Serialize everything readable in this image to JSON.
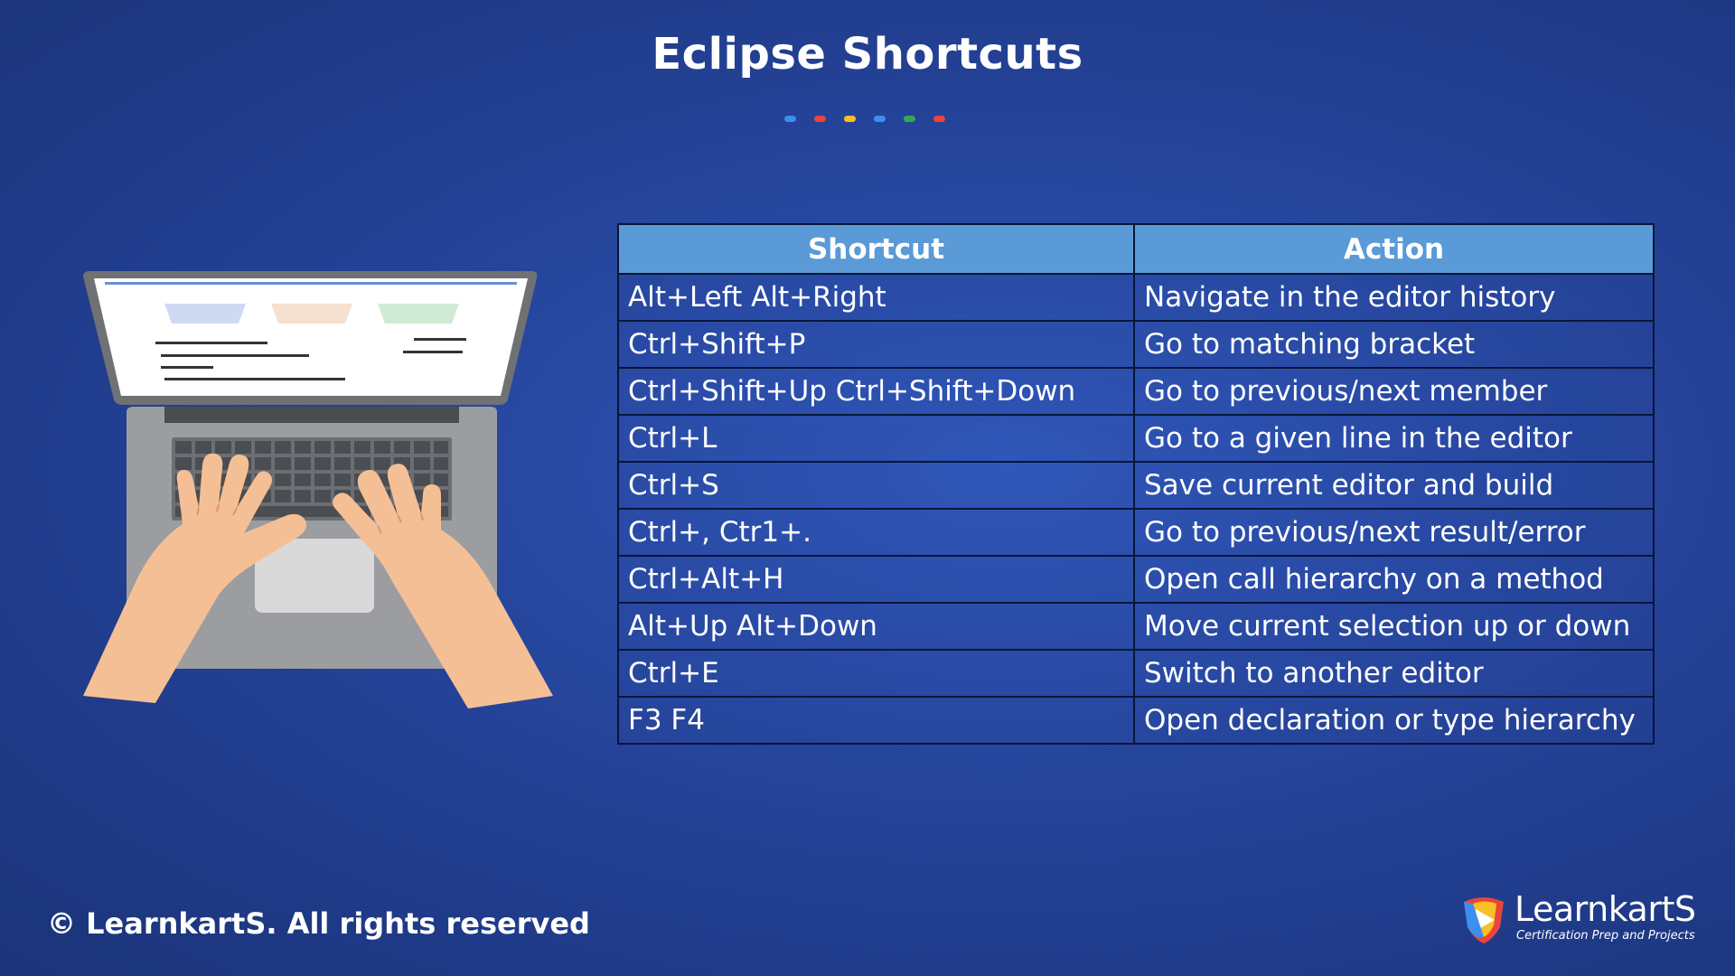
{
  "title": "Eclipse Shortcuts",
  "accent_dots": [
    "#3b8ff0",
    "#e8453c",
    "#f6c026",
    "#3b8ff0",
    "#34a853",
    "#e8453c"
  ],
  "table": {
    "headers": [
      "Shortcut",
      "Action"
    ],
    "rows": [
      {
        "shortcut": "Alt+Left Alt+Right",
        "action": "Navigate in the editor history"
      },
      {
        "shortcut": "Ctrl+Shift+P",
        "action": "Go to matching bracket"
      },
      {
        "shortcut": "Ctrl+Shift+Up Ctrl+Shift+Down",
        "action": "Go to previous/next member"
      },
      {
        "shortcut": "Ctrl+L",
        "action": "Go to a given line in the editor"
      },
      {
        "shortcut": "Ctrl+S",
        "action": "Save current editor and build"
      },
      {
        "shortcut": "Ctrl+, Ctr1+.",
        "action": "Go to previous/next result/error"
      },
      {
        "shortcut": "Ctrl+Alt+H",
        "action": "Open call hierarchy on a method"
      },
      {
        "shortcut": "Alt+Up Alt+Down",
        "action": "Move current selection up or down"
      },
      {
        "shortcut": "Ctrl+E",
        "action": "Switch to another editor"
      },
      {
        "shortcut": "F3 F4",
        "action": "Open declaration or type hierarchy"
      }
    ]
  },
  "colors": {
    "header_bg": "#5a9ad6",
    "grid_line": "#0a1638",
    "background": "#27479f"
  },
  "illustration": {
    "icon": "laptop-typing-illustration"
  },
  "footer": {
    "copyright": "© LearnkartS. All rights reserved"
  },
  "logo": {
    "name": "LearnkartS",
    "tagline": "Certification Prep and Projects"
  }
}
